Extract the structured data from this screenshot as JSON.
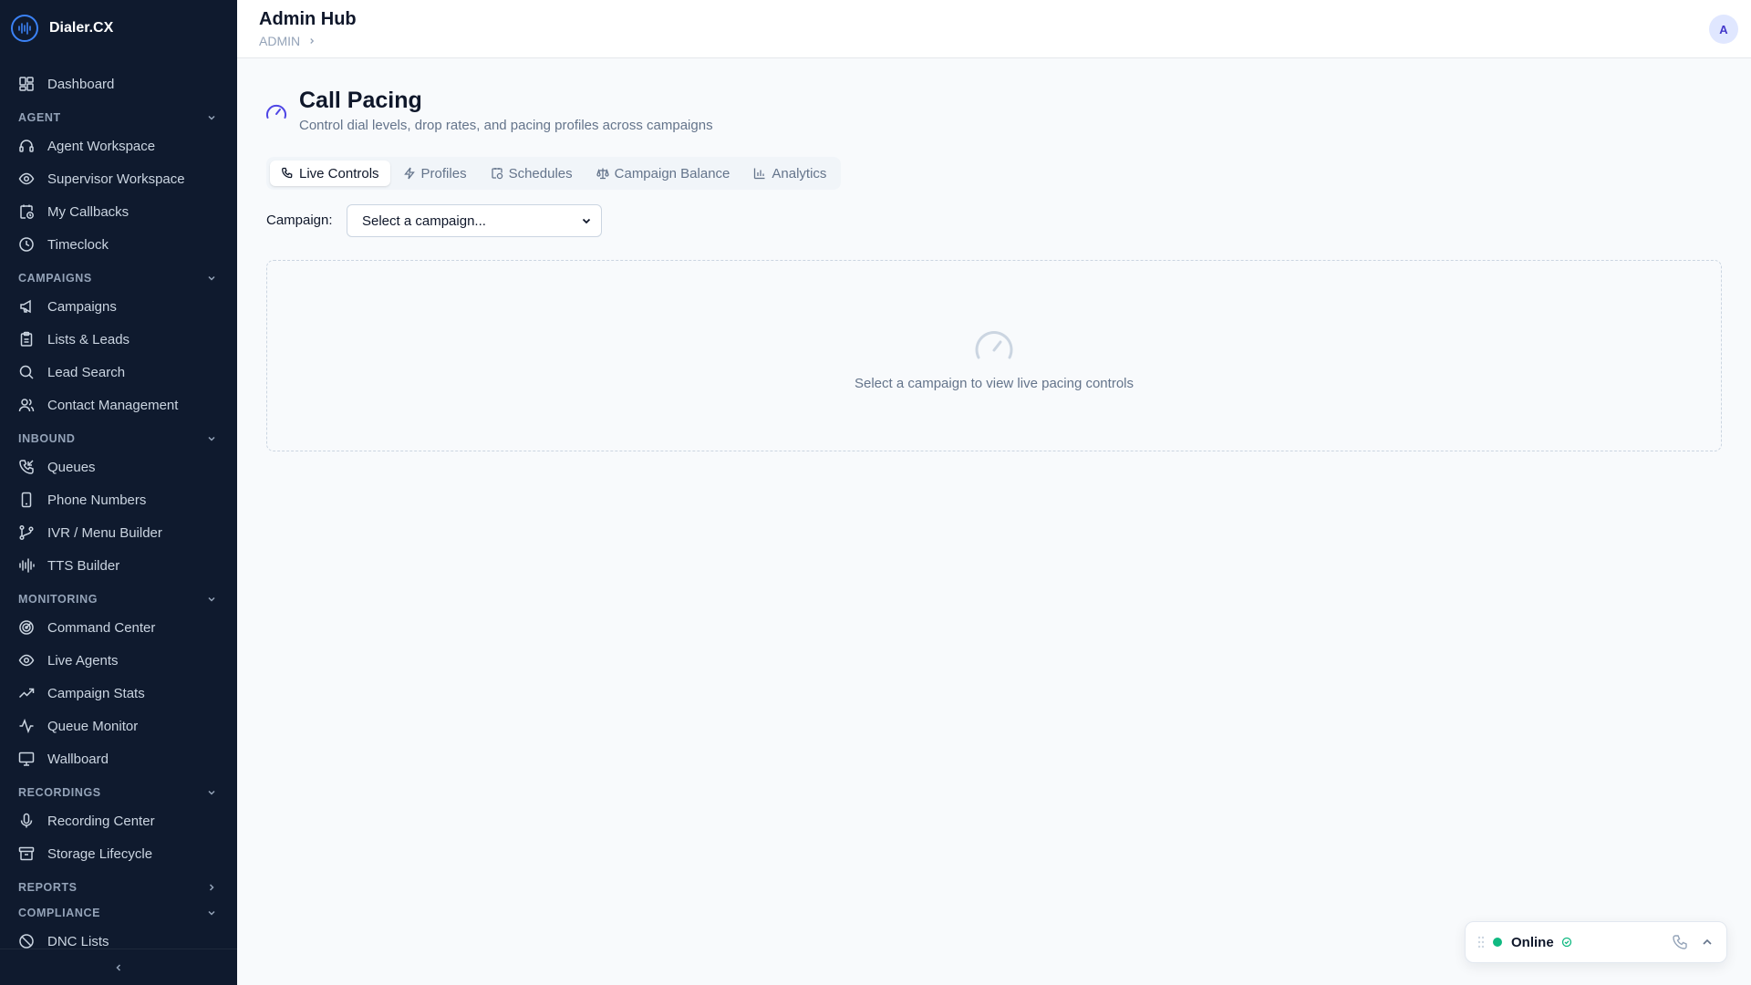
{
  "app": {
    "name": "Dialer.CX",
    "brand_color": "#3b82f6",
    "sidebar_bg": "#0f1a2e"
  },
  "sidebar": {
    "dashboard": {
      "label": "Dashboard",
      "icon": "dashboard-icon"
    },
    "sections": {
      "agent": {
        "label": "AGENT",
        "state": "expanded",
        "items": [
          {
            "label": "Agent Workspace",
            "icon": "headset-icon"
          },
          {
            "label": "Supervisor Workspace",
            "icon": "eye-icon"
          },
          {
            "label": "My Callbacks",
            "icon": "calendar-clock-icon"
          },
          {
            "label": "Timeclock",
            "icon": "clock-icon"
          }
        ]
      },
      "campaigns": {
        "label": "CAMPAIGNS",
        "state": "expanded",
        "items": [
          {
            "label": "Campaigns",
            "icon": "megaphone-icon"
          },
          {
            "label": "Lists & Leads",
            "icon": "clipboard-icon"
          },
          {
            "label": "Lead Search",
            "icon": "search-icon"
          },
          {
            "label": "Contact Management",
            "icon": "users-icon"
          }
        ]
      },
      "inbound": {
        "label": "INBOUND",
        "state": "expanded",
        "items": [
          {
            "label": "Queues",
            "icon": "phone-incoming-icon"
          },
          {
            "label": "Phone Numbers",
            "icon": "smartphone-icon"
          },
          {
            "label": "IVR / Menu Builder",
            "icon": "branch-icon"
          },
          {
            "label": "TTS Builder",
            "icon": "audio-waveform-icon"
          }
        ]
      },
      "monitoring": {
        "label": "MONITORING",
        "state": "expanded",
        "items": [
          {
            "label": "Command Center",
            "icon": "radar-icon"
          },
          {
            "label": "Live Agents",
            "icon": "eye-icon"
          },
          {
            "label": "Campaign Stats",
            "icon": "trending-up-icon"
          },
          {
            "label": "Queue Monitor",
            "icon": "activity-icon"
          },
          {
            "label": "Wallboard",
            "icon": "monitor-icon"
          }
        ]
      },
      "recordings": {
        "label": "RECORDINGS",
        "state": "expanded",
        "items": [
          {
            "label": "Recording Center",
            "icon": "microphone-icon"
          },
          {
            "label": "Storage Lifecycle",
            "icon": "archive-icon"
          }
        ]
      },
      "reports": {
        "label": "REPORTS",
        "state": "collapsed",
        "items": []
      },
      "compliance": {
        "label": "COMPLIANCE",
        "state": "expanded",
        "items": [
          {
            "label": "DNC Lists",
            "icon": "ban-icon"
          }
        ]
      }
    },
    "collapse_icon": "chevron-left-icon"
  },
  "header": {
    "title": "Admin Hub",
    "breadcrumb": "ADMIN",
    "avatar_initial": "A"
  },
  "page": {
    "title": "Call Pacing",
    "subtitle": "Control dial levels, drop rates, and pacing profiles across campaigns",
    "icon": "gauge-icon",
    "accent": "#4f46e5"
  },
  "tabs": [
    {
      "label": "Live Controls",
      "icon": "phone-icon",
      "active": true
    },
    {
      "label": "Profiles",
      "icon": "zap-icon",
      "active": false
    },
    {
      "label": "Schedules",
      "icon": "calendar-clock-icon",
      "active": false
    },
    {
      "label": "Campaign Balance",
      "icon": "scale-icon",
      "active": false
    },
    {
      "label": "Analytics",
      "icon": "bar-chart-icon",
      "active": false
    }
  ],
  "campaign_filter": {
    "label": "Campaign:",
    "selected": "Select a campaign..."
  },
  "empty_state": {
    "text": "Select a campaign to view live pacing controls",
    "icon": "gauge-icon"
  },
  "status_widget": {
    "status": "Online",
    "status_color": "#10b981"
  }
}
